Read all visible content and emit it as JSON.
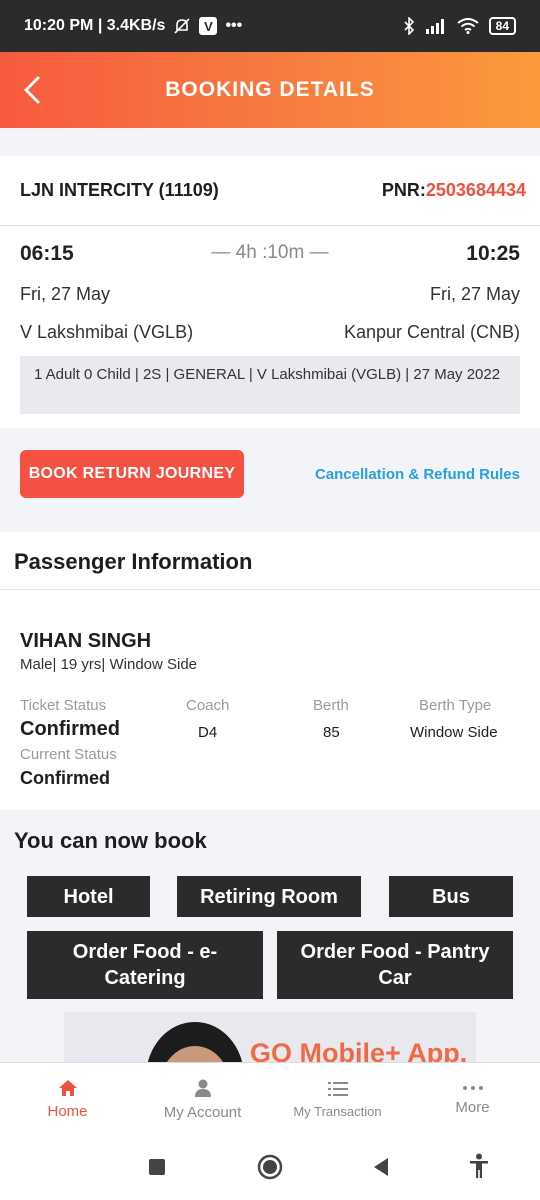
{
  "status_bar": {
    "time_info": "10:20 PM | 3.4KB/s",
    "app_badge": "V",
    "more": "•••",
    "battery": "84"
  },
  "header": {
    "title": "BOOKING DETAILS"
  },
  "train": {
    "name": "LJN INTERCITY (11109)",
    "pnr_label": "PNR:",
    "pnr_number": "2503684434",
    "departure_time": "06:15",
    "arrival_time": "10:25",
    "duration": "— 4h :10m —",
    "departure_date": "Fri, 27 May",
    "arrival_date": "Fri, 27 May",
    "from_station": "V Lakshmibai (VGLB)",
    "to_station": "Kanpur Central (CNB)",
    "summary": "1 Adult 0 Child  | 2S | GENERAL | V Lakshmibai (VGLB) | 27 May 2022"
  },
  "actions": {
    "book_return": "BOOK RETURN JOURNEY",
    "cancellation": "Cancellation & Refund Rules"
  },
  "passenger": {
    "section_title": "Passenger Information",
    "name": "VIHAN SINGH",
    "details": "Male| 19 yrs| Window Side",
    "ticket_status_label": "Ticket Status",
    "ticket_status": "Confirmed",
    "coach_label": "Coach",
    "coach": "D4",
    "berth_label": "Berth",
    "berth": "85",
    "berth_type_label": "Berth Type",
    "berth_type": "Window Side",
    "current_status_label": "Current Status",
    "current_status": "Confirmed"
  },
  "book_more": {
    "title": "You can now book",
    "hotel": "Hotel",
    "retiring_room": "Retiring Room",
    "bus": "Bus",
    "food_ecatering": "Order Food - e-Catering",
    "food_pantry": "Order Food - Pantry Car"
  },
  "banner": {
    "text": "GO Mobile+ App."
  },
  "bottom_nav": {
    "home": "Home",
    "account": "My Account",
    "transaction": "My Transaction",
    "more": "More"
  },
  "colors": {
    "accent": "#f0513f",
    "link": "#2aa0dc",
    "chip": "#2b2b2b"
  }
}
